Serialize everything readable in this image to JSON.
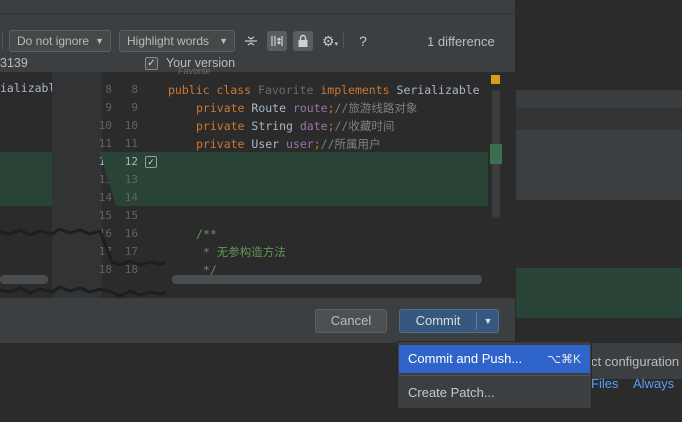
{
  "toolbar": {
    "ignore_select": "Do not ignore",
    "highlight_select": "Highlight words",
    "help_label": "?",
    "diff_count": "1 difference"
  },
  "panes": {
    "left_title_fragment": "3139",
    "your_version_label": "Your version",
    "tooltip_fragment": "Favorite"
  },
  "left_pane": {
    "code_fragment": "ializable"
  },
  "gutter": {
    "left_numbers": [
      "8",
      "9",
      "10",
      "11",
      "12",
      "13",
      "14",
      "15",
      "16",
      "17",
      "18"
    ],
    "right_numbers": [
      "8",
      "9",
      "10",
      "11",
      "12",
      "13",
      "14",
      "15",
      "16",
      "17",
      "18"
    ]
  },
  "code": {
    "line8": {
      "kw1": "public class",
      "name": " Favorite ",
      "kw2": "implements",
      "rest": " Serializable {"
    },
    "line9": {
      "kw": "private",
      "type": " Route ",
      "field": "route",
      "semi": ";",
      "comment": "//旅游线路对象"
    },
    "line10": {
      "kw": "private",
      "type": " String ",
      "field": "date",
      "semi": ";",
      "comment": "//收藏时间"
    },
    "line11": {
      "kw": "private",
      "type": " User ",
      "field": "user",
      "semi": ";",
      "comment": "//所属用户"
    },
    "line16": "/**",
    "line17": " * 无参构造方法",
    "line18": " */"
  },
  "footer": {
    "cancel_label": "Cancel",
    "commit_label": "Commit"
  },
  "popup": {
    "items": [
      {
        "label": "Commit and Push...",
        "shortcut": "⌥⌘K"
      },
      {
        "label": "Create Patch..."
      }
    ]
  },
  "background": {
    "text_configuration": "ct configuration",
    "link_files": "Files",
    "link_always": "Always"
  },
  "colors": {
    "dialog_bg": "#3c3f41",
    "editor_bg": "#2b2b2b",
    "added_bg": "#294436",
    "primary_button": "#365880",
    "menu_selected": "#2f65ca",
    "link": "#589df6"
  }
}
